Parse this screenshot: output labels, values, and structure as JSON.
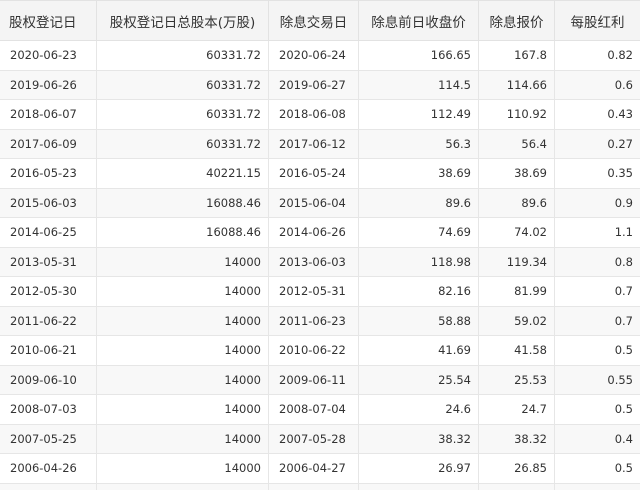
{
  "table": {
    "headers": [
      "股权登记日",
      "股权登记日总股本(万股)",
      "除息交易日",
      "除息前日收盘价",
      "除息报价",
      "每股红利"
    ],
    "rows": [
      [
        "2020-06-23",
        "60331.72",
        "2020-06-24",
        "166.65",
        "167.8",
        "0.82"
      ],
      [
        "2019-06-26",
        "60331.72",
        "2019-06-27",
        "114.5",
        "114.66",
        "0.6"
      ],
      [
        "2018-06-07",
        "60331.72",
        "2018-06-08",
        "112.49",
        "110.92",
        "0.43"
      ],
      [
        "2017-06-09",
        "60331.72",
        "2017-06-12",
        "56.3",
        "56.4",
        "0.27"
      ],
      [
        "2016-05-23",
        "40221.15",
        "2016-05-24",
        "38.69",
        "38.69",
        "0.35"
      ],
      [
        "2015-06-03",
        "16088.46",
        "2015-06-04",
        "89.6",
        "89.6",
        "0.9"
      ],
      [
        "2014-06-25",
        "16088.46",
        "2014-06-26",
        "74.69",
        "74.02",
        "1.1"
      ],
      [
        "2013-05-31",
        "14000",
        "2013-06-03",
        "118.98",
        "119.34",
        "0.8"
      ],
      [
        "2012-05-30",
        "14000",
        "2012-05-31",
        "82.16",
        "81.99",
        "0.7"
      ],
      [
        "2011-06-22",
        "14000",
        "2011-06-23",
        "58.88",
        "59.02",
        "0.7"
      ],
      [
        "2010-06-21",
        "14000",
        "2010-06-22",
        "41.69",
        "41.58",
        "0.5"
      ],
      [
        "2009-06-10",
        "14000",
        "2009-06-11",
        "25.54",
        "25.53",
        "0.55"
      ],
      [
        "2008-07-03",
        "14000",
        "2008-07-04",
        "24.6",
        "24.7",
        "0.5"
      ],
      [
        "2007-05-25",
        "14000",
        "2007-05-28",
        "38.32",
        "38.32",
        "0.4"
      ],
      [
        "2006-04-26",
        "14000",
        "2006-04-27",
        "26.97",
        "26.85",
        "0.5"
      ],
      [
        "",
        "",
        "",
        "",
        "",
        ""
      ]
    ]
  }
}
